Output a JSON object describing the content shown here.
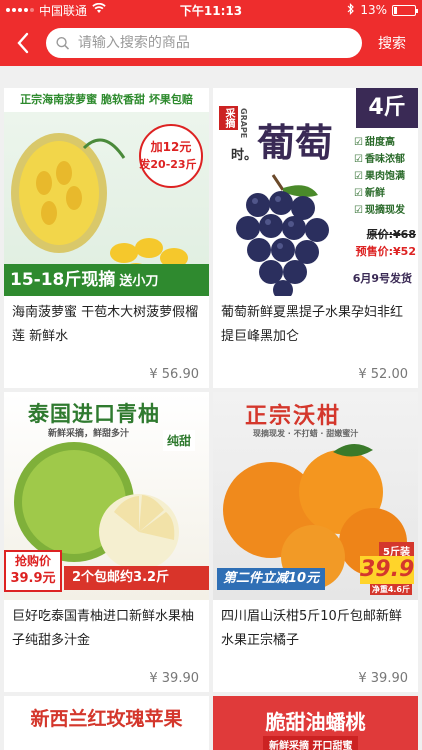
{
  "status_bar": {
    "carrier": "中国联通",
    "time": "下午11:13",
    "battery": "13%",
    "battery_level": 0.13
  },
  "header": {
    "search_placeholder": "请输入搜索的商品",
    "search_button": "搜索"
  },
  "products": [
    {
      "title": "海南菠萝蜜 干苞木大树菠萝假榴莲 新鲜水",
      "price": "¥ 56.90",
      "banner_top": "正宗海南菠萝蜜  脆软香甜 坏果包赔",
      "badge_line1": "加12元",
      "badge_line2": "发20-23斤",
      "banner_bottom": "15-18斤现摘",
      "banner_bottom_small": "送小刀"
    },
    {
      "title": "葡萄新鲜夏黑提子水果孕妇非红提巨峰黑加仑",
      "price": "¥ 52.00",
      "weight": "4斤",
      "calligraphy_small": "采摘",
      "calligraphy_time": "时。",
      "calligraphy_big": "葡萄",
      "brand_en": "GRAPE",
      "features": [
        "甜度高",
        "香味浓郁",
        "果肉饱满",
        "新鲜",
        "现摘现发"
      ],
      "orig_price": "原价:¥68",
      "pre_price": "预售价:¥52",
      "ship": "6月9号发货"
    },
    {
      "title": "巨好吃泰国青柚进口新鲜水果柚子纯甜多汁金",
      "price": "¥ 39.90",
      "banner_top": "泰国进口青柚",
      "subtitle": "新鲜采摘，鲜甜多汁",
      "badge": "纯甜",
      "promo_label": "抢购价",
      "promo_price": "39.9元",
      "promo_text": "2个包邮约3.2斤"
    },
    {
      "title": "四川眉山沃柑5斤10斤包邮新鲜水果正宗橘子",
      "price": "¥ 39.90",
      "banner_top": "正宗沃柑",
      "subtitle": "现摘现发 · 不打蜡 · 甜嫩蜜汁",
      "pack": "5斤装",
      "promo_price": "39.9",
      "net": "净重4.6斤",
      "promo_text": "第二件立减10元"
    }
  ],
  "partial": [
    {
      "banner": "新西兰红玫瑰苹果"
    },
    {
      "banner": "脆甜油蟠桃",
      "sub": "新鲜采摘 开口甜蜜"
    }
  ]
}
